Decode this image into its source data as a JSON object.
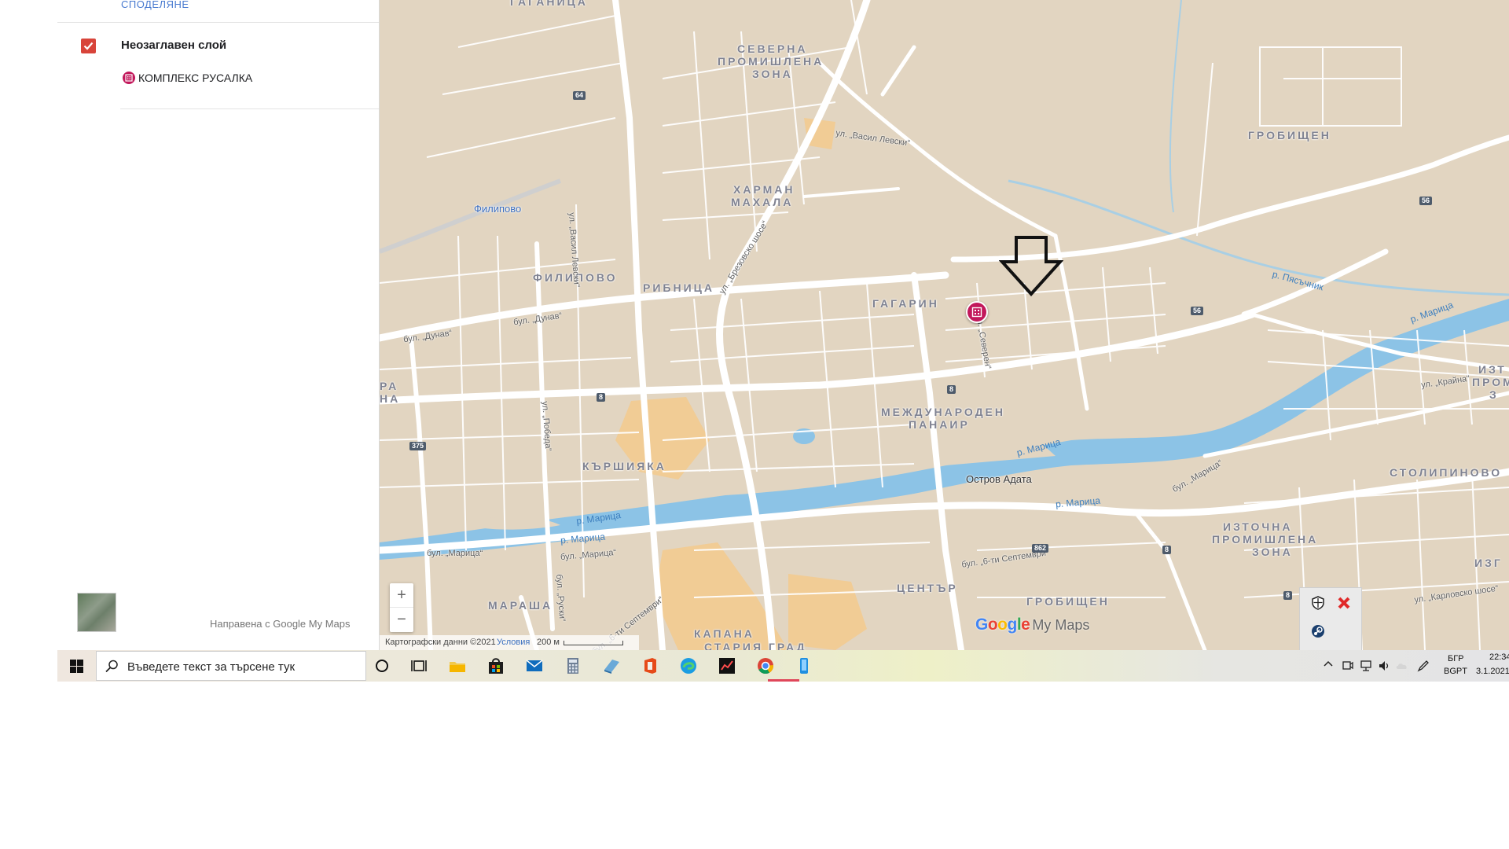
{
  "panel": {
    "share_link": "СПОДЕЛЯНЕ",
    "layer_title": "Неозаглавен слой",
    "place_label": "КОМПЛЕКС РУСАЛКА",
    "made_with": "Направена с Google My Maps"
  },
  "map": {
    "districts": [
      {
        "id": "gaganitsa",
        "text": "ГАГАНИЦА"
      },
      {
        "id": "severna-1",
        "text": "СЕВЕРНА"
      },
      {
        "id": "severna-2",
        "text": "ПРОМИШЛЕНА"
      },
      {
        "id": "severna-3",
        "text": "ЗОНА"
      },
      {
        "id": "harman-1",
        "text": "ХАРМАН"
      },
      {
        "id": "harman-2",
        "text": "МАХАЛА"
      },
      {
        "id": "grobishten-n",
        "text": "ГРОБИЩЕН"
      },
      {
        "id": "filipovo",
        "text": "ФИЛИПОВО"
      },
      {
        "id": "ribnitsa",
        "text": "РИБНИЦА"
      },
      {
        "id": "gagarin",
        "text": "ГАГАРИН"
      },
      {
        "id": "fair-1",
        "text": "МЕЖДУНАРОДЕН"
      },
      {
        "id": "fair-2",
        "text": "ПАНАИР"
      },
      {
        "id": "karshiyaka",
        "text": "КЪРШИЯКА"
      },
      {
        "id": "stolipinovo",
        "text": "СТОЛИПИНОВО"
      },
      {
        "id": "iztochna-1",
        "text": "ИЗТОЧНА"
      },
      {
        "id": "iztochna-2",
        "text": "ПРОМИШЛЕНА"
      },
      {
        "id": "iztochna-3",
        "text": "ЗОНА"
      },
      {
        "id": "marasha",
        "text": "МАРАША"
      },
      {
        "id": "tsentar",
        "text": "ЦЕНТЪР"
      },
      {
        "id": "grobishten-s",
        "text": "ГРОБИЩЕН"
      },
      {
        "id": "kapana",
        "text": "КАПАНА"
      },
      {
        "id": "stariya-grad",
        "text": "СТАРИЯ ГРАД"
      },
      {
        "id": "edge-izt-1",
        "text": "ИЗТ"
      },
      {
        "id": "edge-izt-2",
        "text": "ПРОМ"
      },
      {
        "id": "edge-izt-3",
        "text": "З"
      },
      {
        "id": "edge-izg",
        "text": "ИЗГ"
      },
      {
        "id": "edge-ra",
        "text": "РА"
      },
      {
        "id": "edge-na",
        "text": "НА"
      }
    ],
    "places": {
      "filipovo_station": "Филипово",
      "island": "Остров Адата"
    },
    "streets": [
      {
        "id": "vasil-levski",
        "text": "ул. „Васил Левски“"
      },
      {
        "id": "brezovsko",
        "text": "ул. „Брезовско шосе“"
      },
      {
        "id": "dunav-w",
        "text": "бул. „Дунав“"
      },
      {
        "id": "dunav-e",
        "text": "бул. „Дунав“"
      },
      {
        "id": "pobeda",
        "text": "ул. „Победа“"
      },
      {
        "id": "maritsa-w",
        "text": "бул. „Марица“"
      },
      {
        "id": "maritsa-c",
        "text": "бул. „Марица“"
      },
      {
        "id": "maritsa-e",
        "text": "бул. „Марица“"
      },
      {
        "id": "shesti-sept-1",
        "text": "бул. „6-ти Септември“"
      },
      {
        "id": "shesti-sept-2",
        "text": "бул. „6-ти Септември“"
      },
      {
        "id": "ruski",
        "text": "бул. „Руски“"
      },
      {
        "id": "kraina",
        "text": "ул. „Крайна“"
      },
      {
        "id": "karlovsko",
        "text": "ул. „Карловско шосе“"
      },
      {
        "id": "vasil-ulica",
        "text": "ул. „Васил Левски“"
      },
      {
        "id": "severen",
        "text": "ул. „Северен“"
      }
    ],
    "rivers": [
      {
        "id": "maritsa-1",
        "text": "р. Марица"
      },
      {
        "id": "maritsa-2",
        "text": "р. Марица"
      },
      {
        "id": "maritsa-3",
        "text": "р. Марица"
      },
      {
        "id": "maritsa-4",
        "text": "р. Марица"
      },
      {
        "id": "maritsa-5",
        "text": "р. Марица"
      },
      {
        "id": "pyasachnik",
        "text": "р. Пясъчник"
      }
    ],
    "road_numbers": [
      {
        "id": "r64",
        "text": "64"
      },
      {
        "id": "r56a",
        "text": "56"
      },
      {
        "id": "r56b",
        "text": "56"
      },
      {
        "id": "r8a",
        "text": "8"
      },
      {
        "id": "r8b",
        "text": "8"
      },
      {
        "id": "r8c",
        "text": "8"
      },
      {
        "id": "r8d",
        "text": "8"
      },
      {
        "id": "r375",
        "text": "375"
      },
      {
        "id": "r862",
        "text": "862"
      }
    ],
    "footer": {
      "attribution": "Картографски данни ©2021",
      "terms": "Условия",
      "scale": "200 м"
    },
    "logo": {
      "google": "Google",
      "suffix": "My Maps"
    },
    "zoom_in": "+",
    "zoom_out": "−"
  },
  "taskbar": {
    "search_placeholder": "Въведете текст за търсене тук",
    "apps": [
      "cortana",
      "task-view",
      "file-explorer",
      "store",
      "mail",
      "calculator",
      "app-blue",
      "office",
      "edge",
      "stocks-app",
      "chrome",
      "phone-app"
    ],
    "lang_top": "БГР",
    "lang_bottom": "BGPT",
    "time": "22:34",
    "date": "3.1.2021"
  },
  "colors": {
    "map_bg": "#e2d5c1",
    "road": "#ffffff",
    "water": "#8cc3e6",
    "marker": "#c2185b",
    "checkbox": "#d8443a",
    "link": "#4a7bd0"
  }
}
